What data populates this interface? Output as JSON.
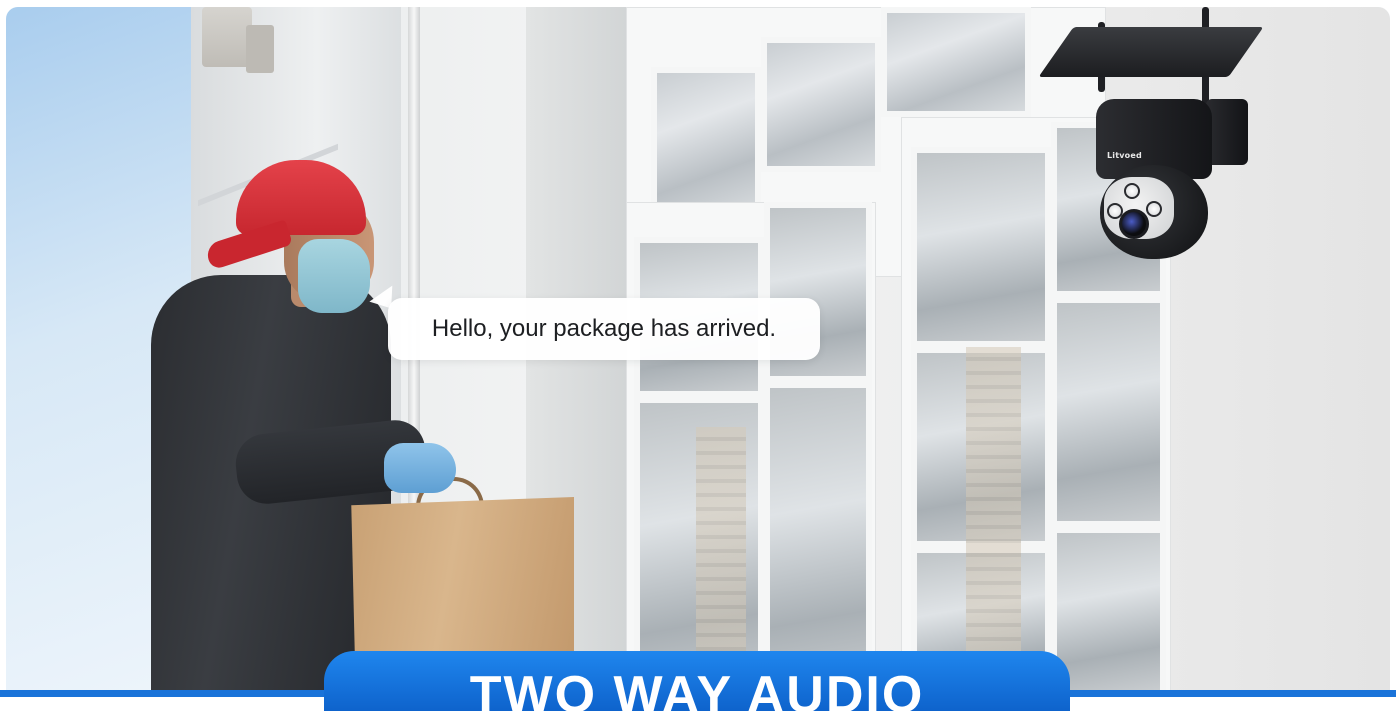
{
  "scene": {
    "speech_bubble": {
      "text": "Hello, your package has arrived."
    },
    "camera": {
      "brand_logo": "Litvoed"
    },
    "banner": {
      "title": "TWO WAY AUDIO",
      "color": "#1a73d9"
    }
  }
}
